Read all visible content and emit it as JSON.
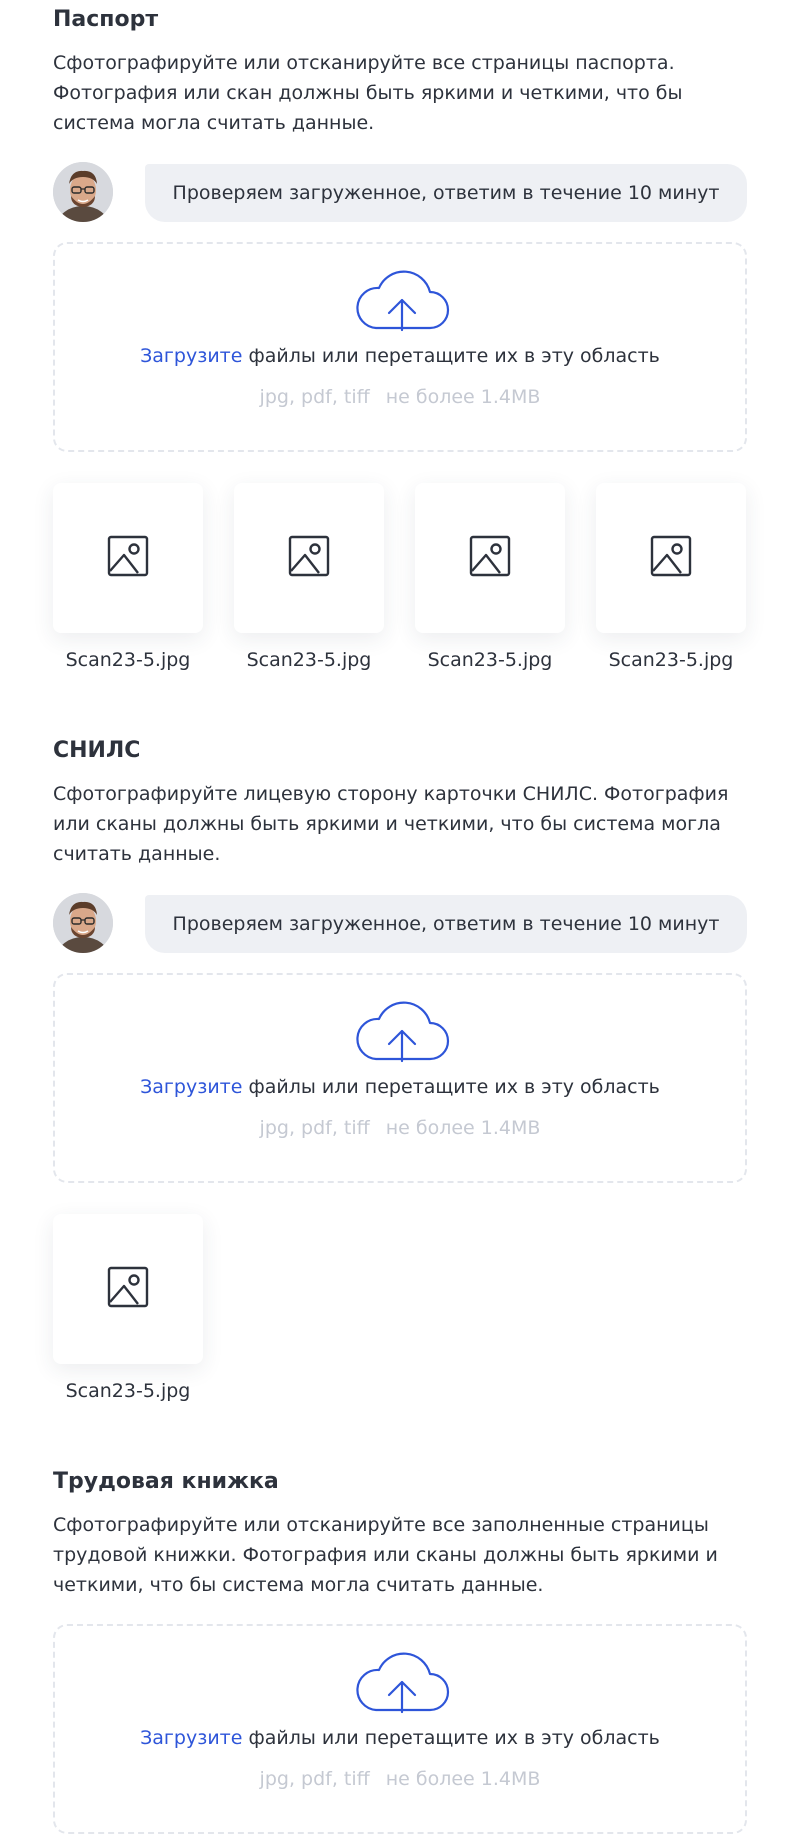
{
  "upload": {
    "link_label": "Загрузите",
    "text_rest": " файлы или перетащите их в эту область",
    "formats": "jpg, pdf, tiff",
    "size_limit": "не более 1.4MB"
  },
  "status_message": "Проверяем загруженное, ответим в течение 10 минут",
  "icons": {
    "upload": "cloud-upload-icon",
    "file": "image-icon",
    "avatar": "avatar-photo"
  },
  "colors": {
    "accent": "#2e55d9",
    "muted": "#c5c9d2",
    "bubble": "#eef0f4",
    "text": "#2d323c"
  },
  "sections": [
    {
      "title": "Паспорт",
      "description": "Сфотографируйте или отсканируйте все страницы паспорта. Фотография или скан должны быть яркими и четкими, что бы система могла считать данные.",
      "status": "Проверяем загруженное, ответим в течение 10 минут",
      "files": [
        "Scan23-5.jpg",
        "Scan23-5.jpg",
        "Scan23-5.jpg",
        "Scan23-5.jpg"
      ]
    },
    {
      "title": "СНИЛС",
      "description": "Сфотографируйте лицевую сторону карточки СНИЛС. Фотография или сканы должны быть яркими и четкими, что бы система могла считать данные.",
      "status": "Проверяем загруженное, ответим в течение 10 минут",
      "files": [
        "Scan23-5.jpg"
      ]
    },
    {
      "title": "Трудовая книжка",
      "description": "Сфотографируйте или отсканируйте все заполненные страницы трудовой книжки. Фотография или сканы должны быть яркими и четкими, что бы система могла считать данные.",
      "files": []
    }
  ]
}
